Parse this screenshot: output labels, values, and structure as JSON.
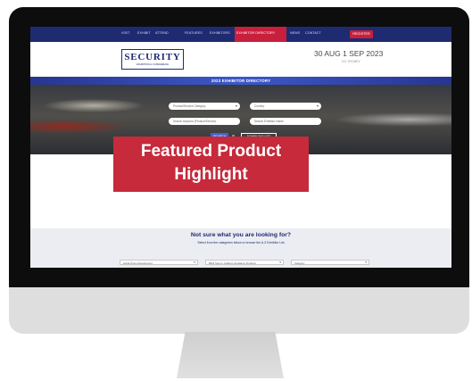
{
  "nav": {
    "items": [
      "VISIT",
      "EXHIBIT",
      "ATTEND",
      "FEATURES",
      "EXHIBITORS",
      "EXHIBITOR DIRECTORY",
      "NEWS",
      "CONTACT"
    ],
    "register_label": "REGISTER"
  },
  "header": {
    "logo_title": "SECURITY",
    "logo_subtitle": "EXHIBITION & CONFERENCE",
    "event_date": "30 AUG 1 SEP 2023",
    "event_venue": "ICC SYDNEY"
  },
  "directory": {
    "title": "2023 EXHIBITOR DIRECTORY"
  },
  "search": {
    "category_placeholder": "Product/Service Category",
    "country_placeholder": "Country",
    "keyword_placeholder": "Search keyword (Product/Service)",
    "company_placeholder": "Search Exhibitor Name",
    "search_label": "SEARCH",
    "or_label": "or",
    "download_label": "DOWNLOAD LIST"
  },
  "featured": {
    "line1": "Featured Product",
    "line2": "Highlight"
  },
  "lower": {
    "heading": "Not sure what you are looking for?",
    "subtext": "Select from the categories below or browse the A-Z Exhibitor List",
    "filters": [
      "Aerial Drone Development",
      "Blind Spot or Collision Avoidance Products",
      "Category"
    ]
  },
  "colors": {
    "navy": "#1f2b71",
    "accent_red": "#c81f3c",
    "featured_red": "#c62a3b",
    "directory_blue": "#3d58c9"
  }
}
